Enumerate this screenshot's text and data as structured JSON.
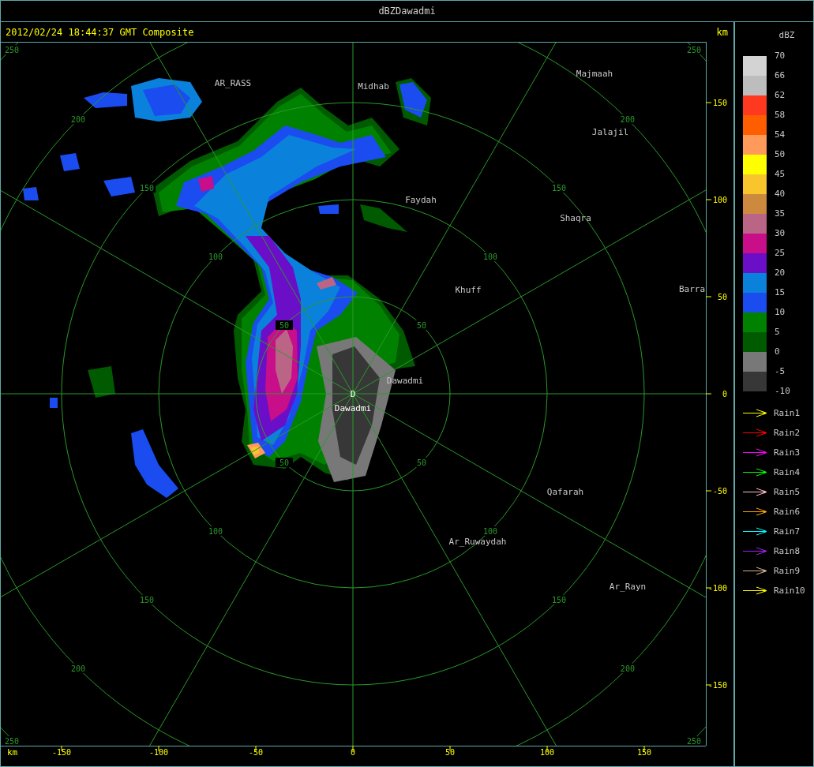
{
  "window": {
    "title": "dBZDawadmi"
  },
  "header": {
    "timestamp": "2012/02/24 18:44:37 GMT Composite",
    "unit": "km"
  },
  "map": {
    "rings": [
      {
        "labels": [
          "50",
          "50",
          "50",
          "50"
        ]
      },
      {
        "labels": [
          "100",
          "100",
          "100",
          "100"
        ]
      },
      {
        "labels": [
          "150",
          "150",
          "150",
          "150"
        ]
      },
      {
        "labels": [
          "200",
          "200",
          "200",
          "200"
        ]
      },
      {
        "labels": [
          "250",
          "250",
          "250",
          "250"
        ]
      }
    ],
    "cities": [
      {
        "name": "AR_RASS"
      },
      {
        "name": "Midhab"
      },
      {
        "name": "Majmaah"
      },
      {
        "name": "Jalajil"
      },
      {
        "name": "Faydah"
      },
      {
        "name": "Shaqra"
      },
      {
        "name": "Khuff"
      },
      {
        "name": "Barra"
      },
      {
        "name": "Dawadmi"
      },
      {
        "name": "Qafarah"
      },
      {
        "name": "Ar_Ruwaydah"
      },
      {
        "name": "Ar_Rayn"
      }
    ],
    "site": {
      "marker": "D",
      "name": "Dawadmi"
    }
  },
  "y_axis": {
    "ticks": [
      "150",
      "100",
      "50",
      "0",
      "-50",
      "-100",
      "-150"
    ]
  },
  "x_axis": {
    "unit": "km",
    "ticks": [
      "-150",
      "-100",
      "-50",
      "0",
      "50",
      "100",
      "150"
    ]
  },
  "legend": {
    "title": "dBZ",
    "scale": [
      {
        "label": "70",
        "color": "#d3d3d3"
      },
      {
        "label": "66",
        "color": "#bdbdbd"
      },
      {
        "label": "62",
        "color": "#ff3820"
      },
      {
        "label": "58",
        "color": "#ff5e00"
      },
      {
        "label": "54",
        "color": "#ff9a5a"
      },
      {
        "label": "50",
        "color": "#ffff00"
      },
      {
        "label": "45",
        "color": "#f8c52c"
      },
      {
        "label": "40",
        "color": "#cd8a3e"
      },
      {
        "label": "35",
        "color": "#bb6586"
      },
      {
        "label": "30",
        "color": "#c80e89"
      },
      {
        "label": "25",
        "color": "#6a0ec8"
      },
      {
        "label": "20",
        "color": "#0a82dc"
      },
      {
        "label": "15",
        "color": "#1a4cf0"
      },
      {
        "label": "10",
        "color": "#008200"
      },
      {
        "label": "5",
        "color": "#005a00"
      },
      {
        "label": "0",
        "color": "#787878"
      },
      {
        "label": "-5",
        "color": "#373737"
      }
    ],
    "bottom_label": "-10",
    "rain": [
      {
        "label": "Rain1",
        "color": "#ffff00"
      },
      {
        "label": "Rain2",
        "color": "#ff0000"
      },
      {
        "label": "Rain3",
        "color": "#ff00ff"
      },
      {
        "label": "Rain4",
        "color": "#00ff00"
      },
      {
        "label": "Rain5",
        "color": "#ffc0cb"
      },
      {
        "label": "Rain6",
        "color": "#ffa500"
      },
      {
        "label": "Rain7",
        "color": "#00ffff"
      },
      {
        "label": "Rain8",
        "color": "#a020f0"
      },
      {
        "label": "Rain9",
        "color": "#d2b48c"
      },
      {
        "label": "Rain10",
        "color": "#ffff00"
      }
    ]
  }
}
